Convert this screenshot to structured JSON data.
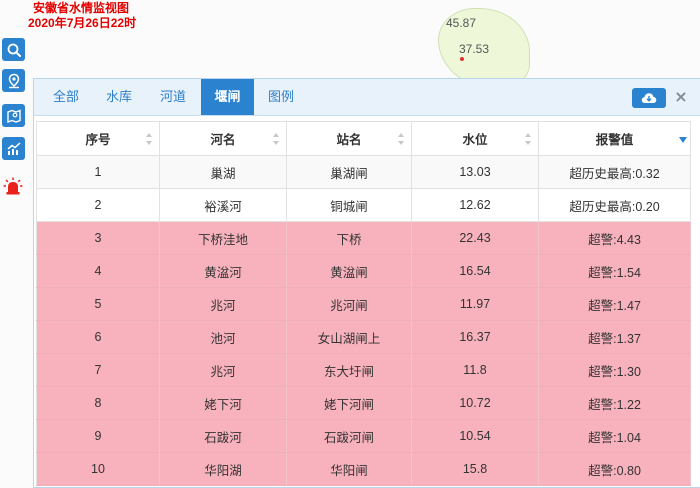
{
  "map": {
    "title_line1": "安徽省水情监视图",
    "title_line2": "2020年7月26日22时",
    "labels": [
      "45.87",
      "37.53"
    ]
  },
  "colors": {
    "accent": "#2b83d0",
    "alarm_row": "#f8b2bd",
    "title_red": "#e40000"
  },
  "toolbar": {
    "icons": [
      "search-icon",
      "location-pin-icon",
      "map-icon",
      "chart-icon",
      "alarm-light-icon"
    ]
  },
  "panel": {
    "tabs": [
      {
        "label": "全部",
        "active": false
      },
      {
        "label": "水库",
        "active": false
      },
      {
        "label": "河道",
        "active": false
      },
      {
        "label": "堰闸",
        "active": true
      },
      {
        "label": "图例",
        "active": false
      }
    ],
    "close_label": "×"
  },
  "table": {
    "headers": [
      "序号",
      "河名",
      "站名",
      "水位",
      "报警值"
    ],
    "rows": [
      [
        "1",
        "巢湖",
        "巢湖闸",
        "13.03",
        "超历史最高:0.32"
      ],
      [
        "2",
        "裕溪河",
        "铜城闸",
        "12.62",
        "超历史最高:0.20"
      ],
      [
        "3",
        "下桥洼地",
        "下桥",
        "22.43",
        "超警:4.43"
      ],
      [
        "4",
        "黄湓河",
        "黄湓闸",
        "16.54",
        "超警:1.54"
      ],
      [
        "5",
        "兆河",
        "兆河闸",
        "11.97",
        "超警:1.47"
      ],
      [
        "6",
        "池河",
        "女山湖闸上",
        "16.37",
        "超警:1.37"
      ],
      [
        "7",
        "兆河",
        "东大圩闸",
        "11.8",
        "超警:1.30"
      ],
      [
        "8",
        "姥下河",
        "姥下河闸",
        "10.72",
        "超警:1.22"
      ],
      [
        "9",
        "石跋河",
        "石跋河闸",
        "10.54",
        "超警:1.04"
      ],
      [
        "10",
        "华阳湖",
        "华阳闸",
        "15.8",
        "超警:0.80"
      ]
    ]
  }
}
